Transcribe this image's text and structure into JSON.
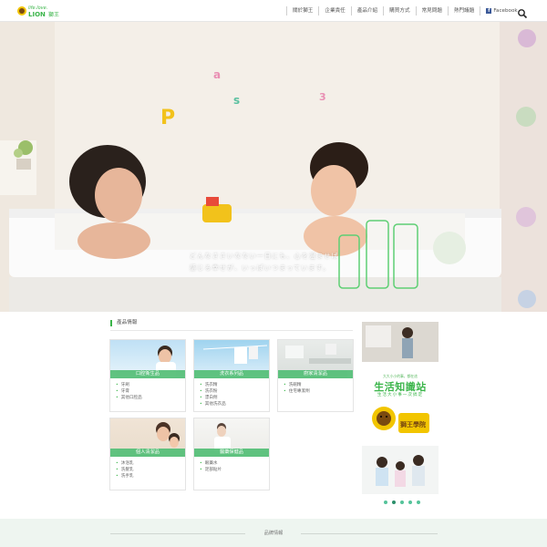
{
  "header": {
    "logo_tagline": "life.love.",
    "logo_brand": "LION",
    "logo_brand_cn": "獅王",
    "nav": [
      "關於獅王",
      "企業責任",
      "產品介紹",
      "購買方式",
      "常見問題",
      "熱門議題"
    ],
    "facebook_label": "Facebook"
  },
  "hero": {
    "tagline_line1": "どんなささいなない一日にも、心を澄ませば",
    "tagline_line2": "感じる幸せが、いっぱいつまっています。"
  },
  "products": {
    "section_title": "產品情報",
    "cards": [
      {
        "label": "口腔衛生品",
        "items": [
          "牙刷",
          "牙膏",
          "其他口腔品"
        ]
      },
      {
        "label": "洗衣系列品",
        "items": [
          "洗衣精",
          "洗衣粉",
          "漂白劑",
          "其他洗衣品"
        ]
      },
      {
        "label": "廚家清潔品",
        "items": [
          "洗碗精",
          "住宅專潔劑"
        ]
      },
      {
        "label": "個人清潔品",
        "items": [
          "沐浴乳",
          "洗髮乳",
          "洗手乳"
        ]
      },
      {
        "label": "醫藥保健品",
        "items": [
          "眼藥水",
          "足部貼片"
        ]
      }
    ]
  },
  "sidebar": {
    "promo_subtitle": "大大小小的事，都在這",
    "promo_title": "生活知識站",
    "promo_caption": "生活大小事一次搞定",
    "mascot_text": "獅王學院"
  },
  "footer": {
    "band_title": "品牌情報"
  },
  "colors": {
    "brand_green": "#3bb54a",
    "label_green": "#58c07a",
    "facebook_blue": "#3b5998"
  }
}
